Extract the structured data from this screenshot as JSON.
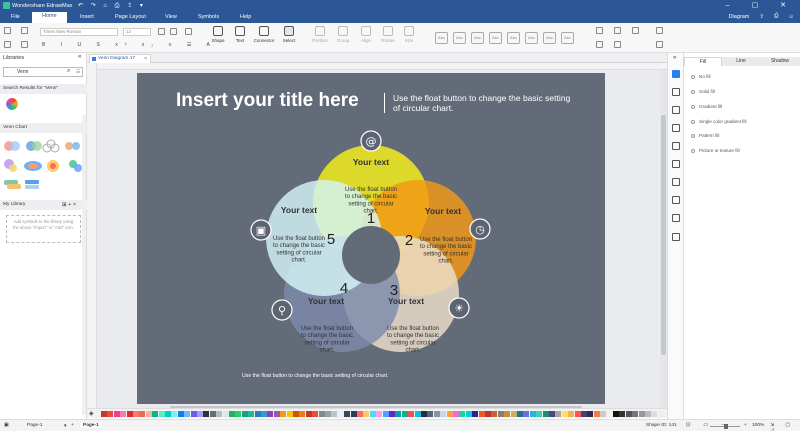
{
  "app": {
    "title": "Wondershare EdrawMax"
  },
  "menu": {
    "items": [
      "File",
      "Home",
      "Insert",
      "Page Layout",
      "View",
      "Symbols",
      "Help"
    ],
    "active": "Home",
    "right_label": "Diagram"
  },
  "ribbon": {
    "font_name": "Times New Roman",
    "font_size": "12",
    "tools": [
      "Shape",
      "Text",
      "Connector",
      "Select",
      "Position",
      "Group",
      "Align",
      "Rotate",
      "Size"
    ],
    "style_label": "Abc"
  },
  "libraries": {
    "title": "Libraries",
    "search_value": "Venn",
    "search_results_header": "Search Results for \"Venn\"",
    "venn_chart_header": "Venn Chart",
    "my_library_header": "My Library",
    "my_library_hint": "Add symbols to the library using the above \"Import\" or \"Add\" icon."
  },
  "document": {
    "tab_name": "Venn Diagram 17"
  },
  "diagram": {
    "title": "Insert your title here",
    "subtitle": "Use the float button to change the basic setting of circular chart.",
    "footer_note": "Use the float button to change the basic setting of circular chart.",
    "petals": [
      {
        "number": "1",
        "heading": "Your text",
        "body": "Use the float button to change the basic setting of circular chart.",
        "color": "#f7f21a",
        "icon": "at-icon"
      },
      {
        "number": "2",
        "heading": "Your text",
        "body": "Use the float button to change the basic setting of circular chart.",
        "color": "#f39813",
        "icon": "clock-icon"
      },
      {
        "number": "3",
        "heading": "Your text",
        "body": "Use the float button to change the basic setting of circular chart.",
        "color": "#ede0cc",
        "icon": "lightbulb-icon"
      },
      {
        "number": "4",
        "heading": "Your text",
        "body": "Use the float button to change the basic setting of circular chart.",
        "color": "#7e8aac",
        "icon": "bicycle-icon"
      },
      {
        "number": "5",
        "heading": "Your text",
        "body": "Use the float button to change the basic setting of circular chart.",
        "color": "#d3f4f6",
        "icon": "camera-icon"
      }
    ]
  },
  "fill_panel": {
    "tabs": [
      "Fill",
      "Line",
      "Shadow"
    ],
    "active_tab": "Fill",
    "options": [
      "No fill",
      "Solid fill",
      "Gradient fill",
      "Single color gradient fill",
      "Pattern fill",
      "Picture or texture fill"
    ]
  },
  "status": {
    "page_selector": "Page-1",
    "page_tab": "Page-1",
    "shape_id": "Shape ID: 141",
    "zoom": "100%"
  },
  "palette_colors": [
    "#c0392b",
    "#e74c3c",
    "#e84393",
    "#fd79a8",
    "#d63031",
    "#ff7675",
    "#e17055",
    "#fab1a0",
    "#00b894",
    "#55efc4",
    "#00cec9",
    "#81ecec",
    "#0984e3",
    "#74b9ff",
    "#6c5ce7",
    "#a29bfe",
    "#2d3436",
    "#636e72",
    "#b2bec3",
    "#dfe6e9",
    "#27ae60",
    "#2ecc71",
    "#16a085",
    "#1abc9c",
    "#2980b9",
    "#3498db",
    "#8e44ad",
    "#9b59b6",
    "#f39c12",
    "#f1c40f",
    "#d35400",
    "#e67e22",
    "#c0392b",
    "#e74c3c",
    "#7f8c8d",
    "#95a5a6",
    "#bdc3c7",
    "#ecf0f1",
    "#34495e",
    "#2c3e50",
    "#ff6b6b",
    "#feca57",
    "#48dbfb",
    "#ff9ff3",
    "#54a0ff",
    "#5f27cd",
    "#01a3a4",
    "#10ac84",
    "#ee5253",
    "#0abde3",
    "#222f3e",
    "#576574",
    "#8395a7",
    "#c8d6e5",
    "#ff9f43",
    "#f368e0",
    "#1dd1a1",
    "#00d2d3",
    "#341f97",
    "#ee5a24",
    "#b33939",
    "#cd6133",
    "#84817a",
    "#cc8e35",
    "#ccae62",
    "#227093",
    "#706fd3",
    "#34ace0",
    "#33d9b2",
    "#218c74",
    "#474787",
    "#aaa69d",
    "#ffda79",
    "#ffb142",
    "#ff5252",
    "#40407a",
    "#2c2c54",
    "#ff793f",
    "#d1ccc0",
    "#f7f1e3",
    "#111111",
    "#333333",
    "#555555",
    "#777777",
    "#999999",
    "#bbbbbb",
    "#dddddd",
    "#eeeeee"
  ]
}
